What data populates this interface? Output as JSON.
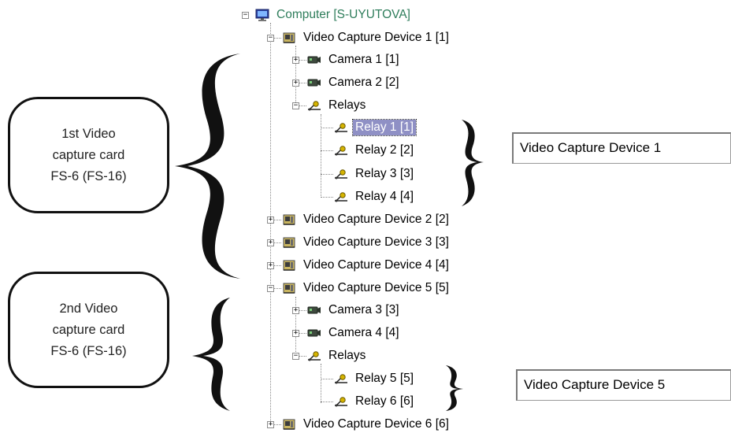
{
  "tree": {
    "root": "Computer [S-UYUTOVA]",
    "device1": "Video Capture Device 1 [1]",
    "camera1": "Camera 1 [1]",
    "camera2": "Camera 2 [2]",
    "relays1": "Relays",
    "relay1": "Relay 1 [1]",
    "relay2": "Relay 2 [2]",
    "relay3": "Relay 3 [3]",
    "relay4": "Relay 4 [4]",
    "device2": "Video Capture Device 2 [2]",
    "device3": "Video Capture Device 3 [3]",
    "device4": "Video Capture Device 4 [4]",
    "device5": "Video Capture Device 5 [5]",
    "camera3": "Camera 3 [3]",
    "camera4": "Camera 4 [4]",
    "relays2": "Relays",
    "relay5": "Relay 5 [5]",
    "relay6": "Relay 6 [6]",
    "device6": "Video Capture Device 6 [6]"
  },
  "callouts": {
    "first": {
      "line1": "1st Video",
      "line2": "capture card",
      "line3": "FS-6 (FS-16)"
    },
    "second": {
      "line1": "2nd Video",
      "line2": "capture card",
      "line3": "FS-6 (FS-16)"
    }
  },
  "boxes": {
    "device1": "Video Capture Device 1",
    "device5": "Video Capture Device 5"
  },
  "icons": {
    "computer": "monitor-icon",
    "device": "capture-card-icon",
    "camera": "camera-icon",
    "relay": "relay-icon"
  }
}
